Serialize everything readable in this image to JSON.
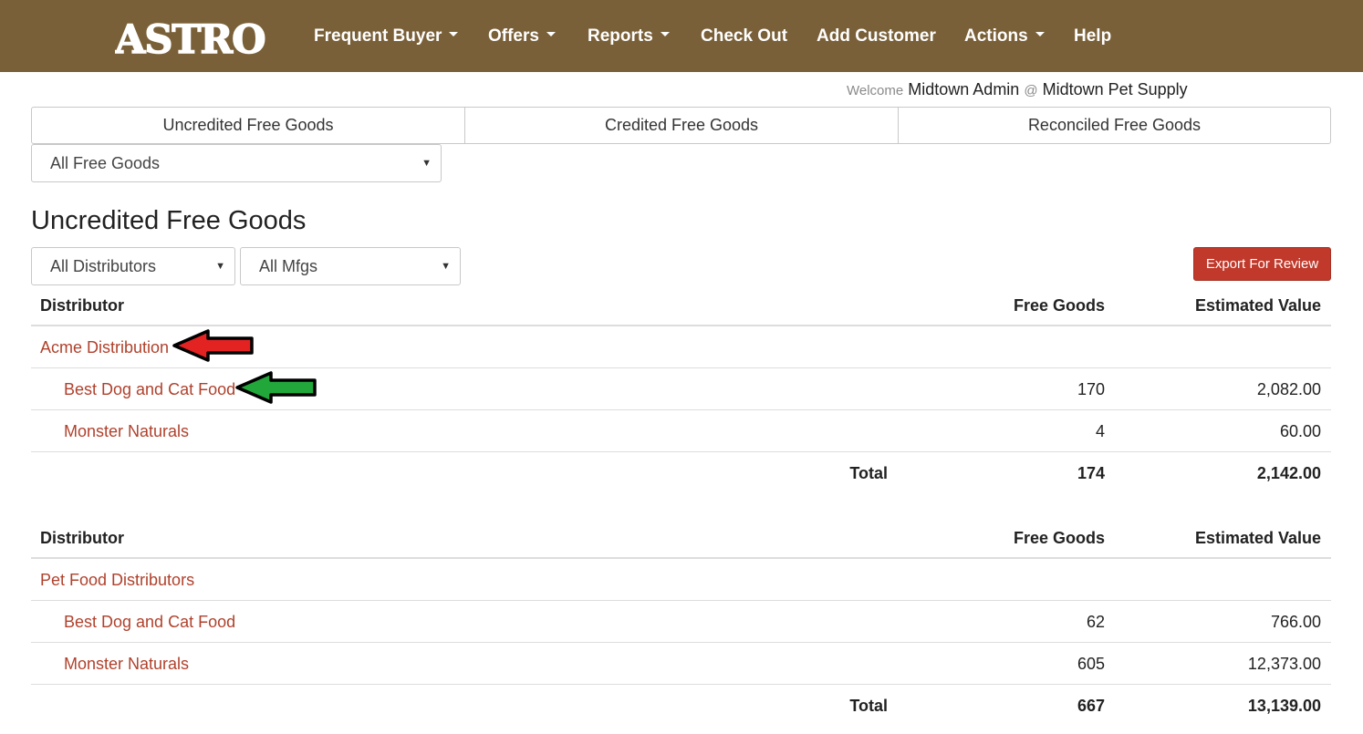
{
  "navbar": {
    "brand": "ASTRO",
    "items": [
      {
        "label": "Frequent Buyer",
        "dropdown": true
      },
      {
        "label": "Offers",
        "dropdown": true
      },
      {
        "label": "Reports",
        "dropdown": true
      },
      {
        "label": "Check Out",
        "dropdown": false
      },
      {
        "label": "Add Customer",
        "dropdown": false
      },
      {
        "label": "Actions",
        "dropdown": true
      },
      {
        "label": "Help",
        "dropdown": false
      }
    ],
    "background": "#7a6038"
  },
  "welcome": {
    "prefix": "Welcome",
    "user": "Midtown Admin",
    "at": "@",
    "store": "Midtown Pet Supply"
  },
  "tabs": [
    "Uncredited Free Goods",
    "Credited Free Goods",
    "Reconciled Free Goods"
  ],
  "filters": {
    "goods_filter": "All Free Goods",
    "distributor_filter": "All Distributors",
    "mfg_filter": "All Mfgs"
  },
  "page_title": "Uncredited Free Goods",
  "export_button": "Export For Review",
  "accent_color": "#c0392b",
  "tables": [
    {
      "headers": {
        "distributor": "Distributor",
        "free_goods": "Free Goods",
        "estimated_value": "Estimated Value"
      },
      "distributor": "Acme Distribution",
      "rows": [
        {
          "mfg": "Best Dog and Cat Food",
          "free_goods": "170",
          "estimated_value": "2,082.00"
        },
        {
          "mfg": "Monster Naturals",
          "free_goods": "4",
          "estimated_value": "60.00"
        }
      ],
      "total": {
        "label": "Total",
        "free_goods": "174",
        "estimated_value": "2,142.00"
      }
    },
    {
      "headers": {
        "distributor": "Distributor",
        "free_goods": "Free Goods",
        "estimated_value": "Estimated Value"
      },
      "distributor": "Pet Food Distributors",
      "rows": [
        {
          "mfg": "Best Dog and Cat Food",
          "free_goods": "62",
          "estimated_value": "766.00"
        },
        {
          "mfg": "Monster Naturals",
          "free_goods": "605",
          "estimated_value": "12,373.00"
        }
      ],
      "total": {
        "label": "Total",
        "free_goods": "667",
        "estimated_value": "13,139.00"
      }
    }
  ],
  "annotations": [
    {
      "icon": "red-arrow-left-icon",
      "color": "#e32222"
    },
    {
      "icon": "green-arrow-left-icon",
      "color": "#22a83a"
    }
  ]
}
